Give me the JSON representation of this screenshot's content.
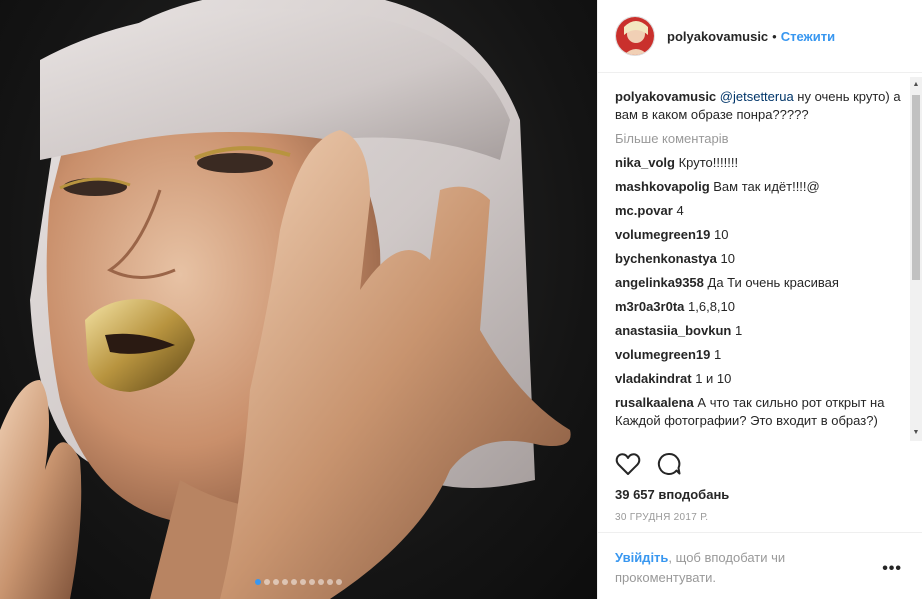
{
  "post": {
    "username": "polyakovamusic",
    "separator": "•",
    "follow_label": "Стежити",
    "image_alt_icon": "photo",
    "carousel_count": 10,
    "carousel_active_index": 0
  },
  "comments": {
    "caption": {
      "user": "polyakovamusic",
      "mention": "@jetsetterua",
      "text": " ну очень круто) а вам в каком образе понра?????"
    },
    "load_more": "Більше коментарів",
    "items": [
      {
        "user": "nika_volg",
        "text": "Круто!!!!!!!"
      },
      {
        "user": "mashkovapolig",
        "text": "Вам так идёт!!!!@"
      },
      {
        "user": "mc.povar",
        "text": "4"
      },
      {
        "user": "volumegreen19",
        "text": "10"
      },
      {
        "user": "bychenkonastya",
        "text": "10"
      },
      {
        "user": "angelinka9358",
        "text": "Да Ти очень красивая"
      },
      {
        "user": "m3r0a3r0ta",
        "text": "1,6,8,10"
      },
      {
        "user": "anastasiia_bovkun",
        "text": "1"
      },
      {
        "user": "volumegreen19",
        "text": "1"
      },
      {
        "user": "vladakindrat",
        "text": "1 и 10"
      },
      {
        "user": "rusalkaalena",
        "text": "А что так сильно рот открыт на Каждой фотографии? Это входит в образ?)"
      }
    ]
  },
  "stats": {
    "likes": "39 657 вподобань",
    "date": "30 ГРУДНЯ 2017 Р."
  },
  "footer": {
    "login_link": "Увійдіть",
    "login_text": ", щоб вподобати чи прокоментувати.",
    "more_options": "•••"
  },
  "colors": {
    "accent": "#3897f0",
    "mention": "#003569",
    "muted": "#999999"
  }
}
